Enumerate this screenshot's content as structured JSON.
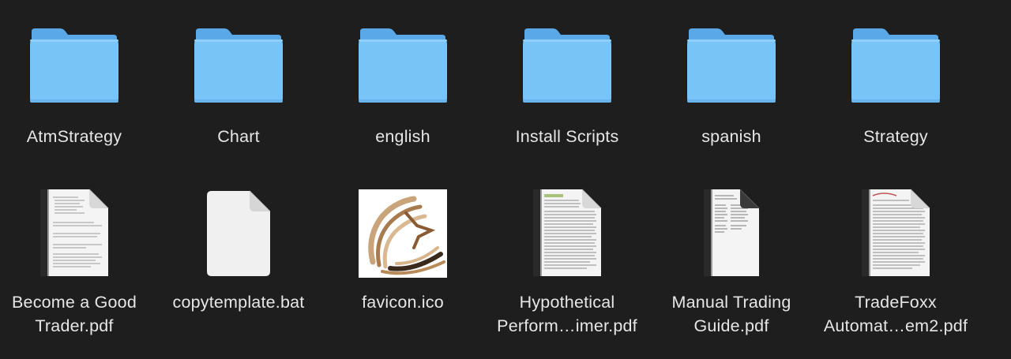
{
  "items": [
    {
      "name": "AtmStrategy",
      "kind": "folder"
    },
    {
      "name": "Chart",
      "kind": "folder"
    },
    {
      "name": "english",
      "kind": "folder"
    },
    {
      "name": "Install Scripts",
      "kind": "folder"
    },
    {
      "name": "spanish",
      "kind": "folder"
    },
    {
      "name": "Strategy",
      "kind": "folder"
    },
    {
      "name": "Become a Good\nTrader.pdf",
      "kind": "pdf"
    },
    {
      "name": "copytemplate.bat",
      "kind": "blank-document"
    },
    {
      "name": "favicon.ico",
      "kind": "image"
    },
    {
      "name": "Hypothetical\nPerform…imer.pdf",
      "kind": "pdf"
    },
    {
      "name": "Manual Trading\nGuide.pdf",
      "kind": "pdf"
    },
    {
      "name": "TradeFoxx\nAutomat…em2.pdf",
      "kind": "pdf"
    }
  ],
  "colors": {
    "background": "#1e1e1e",
    "folder_front": "#79c4f7",
    "folder_back": "#5ba8e8",
    "label_text": "#e6e6e6"
  }
}
